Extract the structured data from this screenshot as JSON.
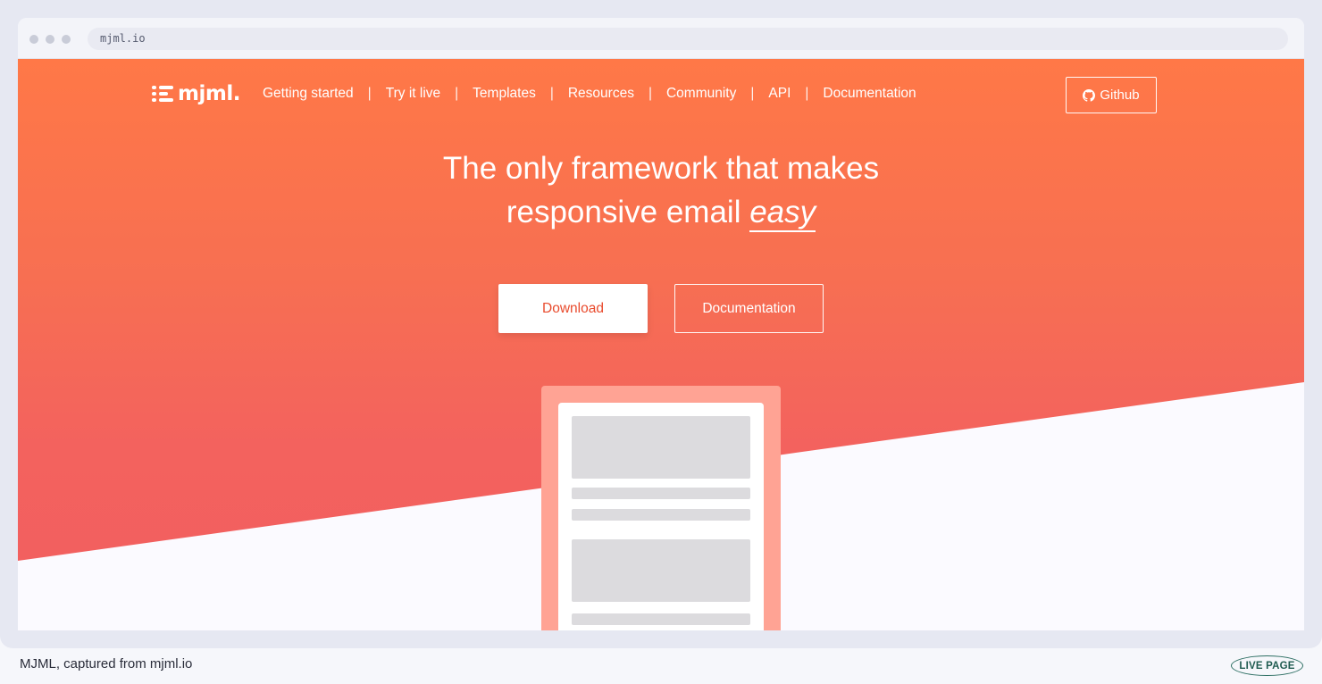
{
  "browser": {
    "url": "mjml.io"
  },
  "site": {
    "logo_text": "mjml.",
    "nav": [
      {
        "label": "Getting started"
      },
      {
        "label": "Try it live"
      },
      {
        "label": "Templates"
      },
      {
        "label": "Resources"
      },
      {
        "label": "Community"
      },
      {
        "label": "API"
      },
      {
        "label": "Documentation"
      }
    ],
    "nav_separator": "|",
    "github_label": "Github",
    "headline_line1": "The only framework that makes",
    "headline_line2": "responsive email",
    "headline_emphasis": "easy",
    "download_label": "Download",
    "documentation_label": "Documentation"
  },
  "colors": {
    "brand_orange": "#ff7847",
    "brand_red": "#f25e60",
    "download_text": "#e94b2d",
    "device_frame": "#ffa394"
  },
  "icons": {
    "github": "github-icon",
    "logo": "mjml-logo-icon"
  },
  "footer": {
    "caption": "MJML, captured from mjml.io",
    "badge": "LIVE PAGE"
  }
}
